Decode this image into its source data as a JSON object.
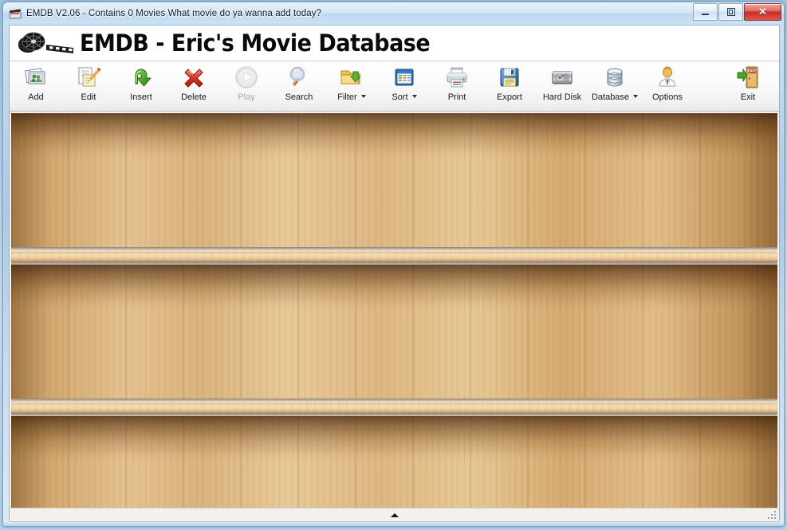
{
  "window": {
    "title": "EMDB V2.06 - Contains 0 Movies What movie do ya wanna add today?",
    "icon": "clapperboard-icon",
    "controls": {
      "minimize": "Minimize",
      "restore": "Restore",
      "close": "✕"
    }
  },
  "banner": {
    "app_title": "EMDB - Eric's Movie Database",
    "logo": "film-reel-icon"
  },
  "toolbar": {
    "items": [
      {
        "label": "Add",
        "icon": "photos-icon",
        "disabled": false,
        "dropdown": false
      },
      {
        "label": "Edit",
        "icon": "document-pencil-icon",
        "disabled": false,
        "dropdown": false
      },
      {
        "label": "Insert",
        "icon": "green-arrow-icon",
        "disabled": false,
        "dropdown": false
      },
      {
        "label": "Delete",
        "icon": "red-x-icon",
        "disabled": false,
        "dropdown": false
      },
      {
        "label": "Play",
        "icon": "play-circle-icon",
        "disabled": true,
        "dropdown": false
      },
      {
        "label": "Search",
        "icon": "magnifier-icon",
        "disabled": false,
        "dropdown": false
      },
      {
        "label": "Filter",
        "icon": "folder-arrow-icon",
        "disabled": false,
        "dropdown": true
      },
      {
        "label": "Sort",
        "icon": "table-icon",
        "disabled": false,
        "dropdown": true
      },
      {
        "label": "Print",
        "icon": "printer-icon",
        "disabled": false,
        "dropdown": false
      },
      {
        "label": "Export",
        "icon": "floppy-disk-icon",
        "disabled": false,
        "dropdown": false
      },
      {
        "label": "Hard Disk",
        "icon": "harddisk-icon",
        "disabled": false,
        "dropdown": false
      },
      {
        "label": "Database",
        "icon": "database-icon",
        "disabled": false,
        "dropdown": true
      },
      {
        "label": "Options",
        "icon": "person-icon",
        "disabled": false,
        "dropdown": false
      },
      {
        "label": "Exit",
        "icon": "exit-door-icon",
        "disabled": false,
        "dropdown": false
      }
    ]
  },
  "shelf": {
    "rows": 3,
    "movie_count": 0,
    "items": [],
    "wood_color": "#ddb67f",
    "shelf_highlight": "#f3dcb4",
    "shadow_color": "#3a1c06"
  },
  "bottombar": {
    "collapse_arrow": "up-triangle-icon"
  }
}
